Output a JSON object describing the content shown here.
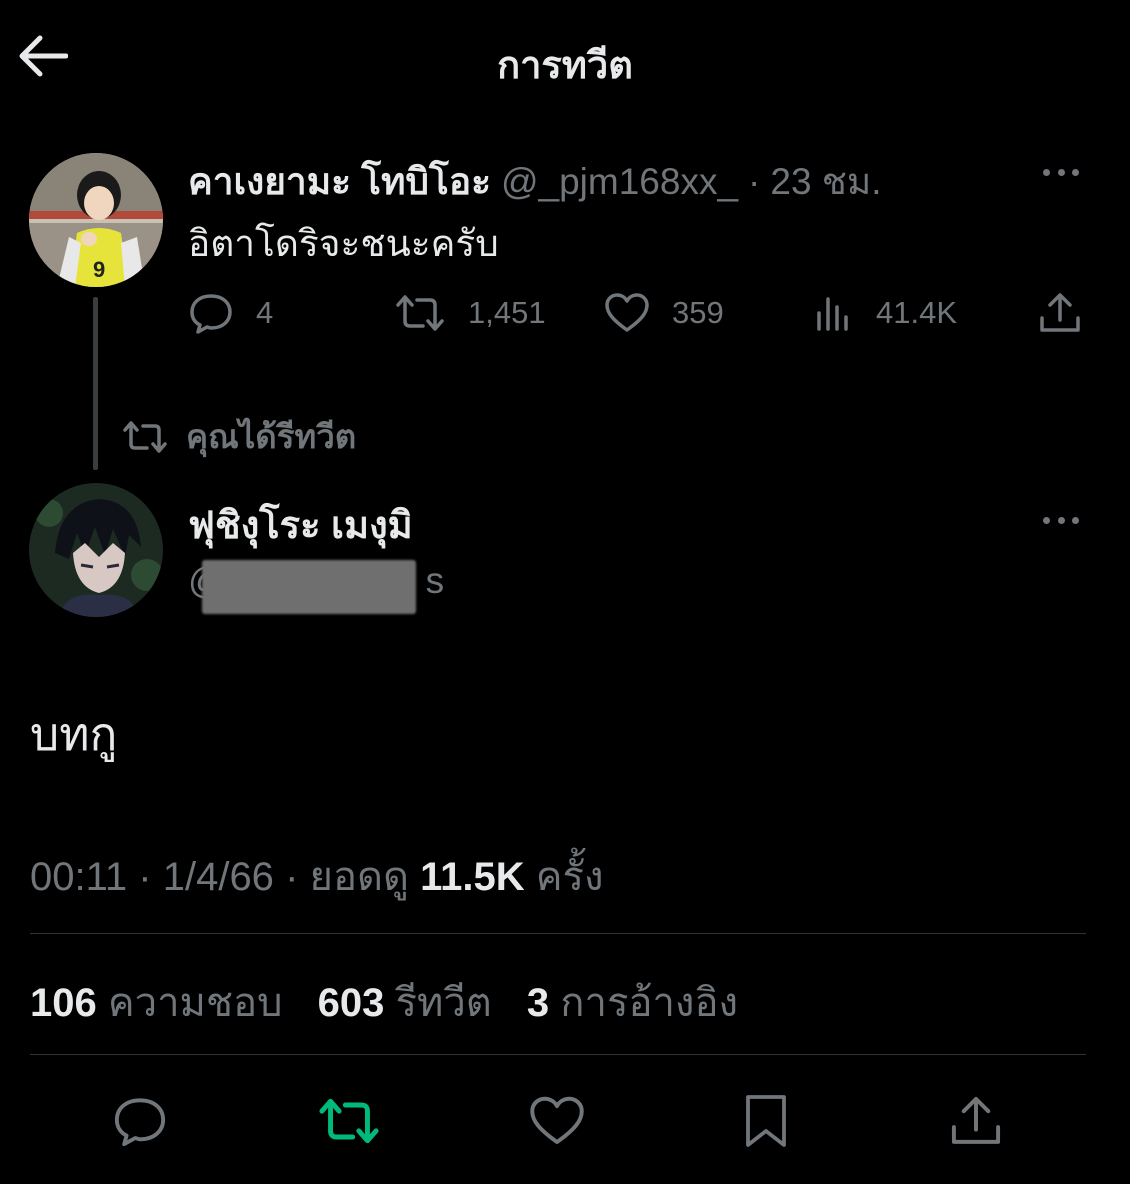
{
  "header": {
    "title": "การทวีต"
  },
  "quoted_tweet": {
    "name": "คาเงยามะ โทบิโอะ",
    "handle": "@_pjm168xx_",
    "separator": "·",
    "time": "23 ชม.",
    "text": "อิตาโดริจะชนะครับ",
    "reply_count": "4",
    "retweet_count": "1,451",
    "like_count": "359",
    "view_count": "41.4K"
  },
  "retweet_label": "คุณได้รีทวีต",
  "main_tweet": {
    "name": "ฟุชิงุโระ เมงุมิ",
    "handle_visible": "@",
    "handle_tail": "s",
    "text": "บทกู",
    "time": "00:11",
    "date": "1/4/66",
    "views_label": "ยอดดู",
    "views_value": "11.5K",
    "views_suffix": "ครั้ง",
    "sep": "·"
  },
  "stats": {
    "likes_value": "106",
    "likes_label": "ความชอบ",
    "retweets_value": "603",
    "retweets_label": "รีทวีต",
    "quotes_value": "3",
    "quotes_label": "การอ้างอิง"
  },
  "colors": {
    "background": "#000000",
    "text_primary": "#e7e9ea",
    "text_secondary": "#71767b",
    "retweet_active": "#00ba7c",
    "divider": "#2f3336"
  },
  "icons": {
    "back": "arrow-left-icon",
    "more": "more-dots-icon",
    "reply": "reply-bubble-icon",
    "retweet": "retweet-icon",
    "like": "heart-icon",
    "views": "views-bar-icon",
    "share": "share-icon",
    "bookmark": "bookmark-icon"
  }
}
